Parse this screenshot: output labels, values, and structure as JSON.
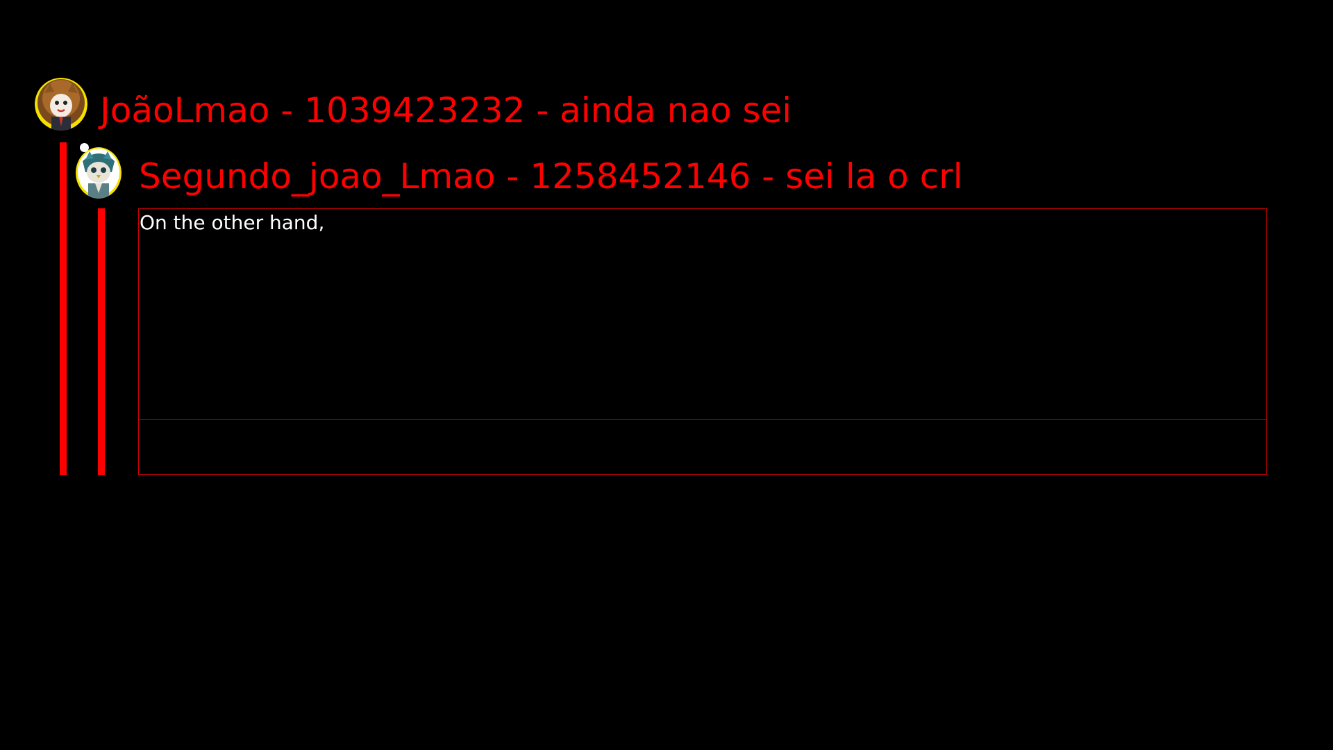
{
  "colors": {
    "background": "#000000",
    "accent": "#ff0000",
    "box_border": "#cc0000",
    "reply_text": "#ffffff",
    "avatar_ring": "#f5e100",
    "online_dot": "#ffffff"
  },
  "thread": {
    "parent": {
      "header": "JoãoLmao - 1039423232 - ainda nao sei",
      "avatar_icon": "lion-character-avatar-icon"
    },
    "reply": {
      "header": "Segundo_joao_Lmao - 1258452146 - sei la o crl",
      "avatar_icon": "owl-character-avatar-icon",
      "body": "On the other hand,"
    }
  }
}
